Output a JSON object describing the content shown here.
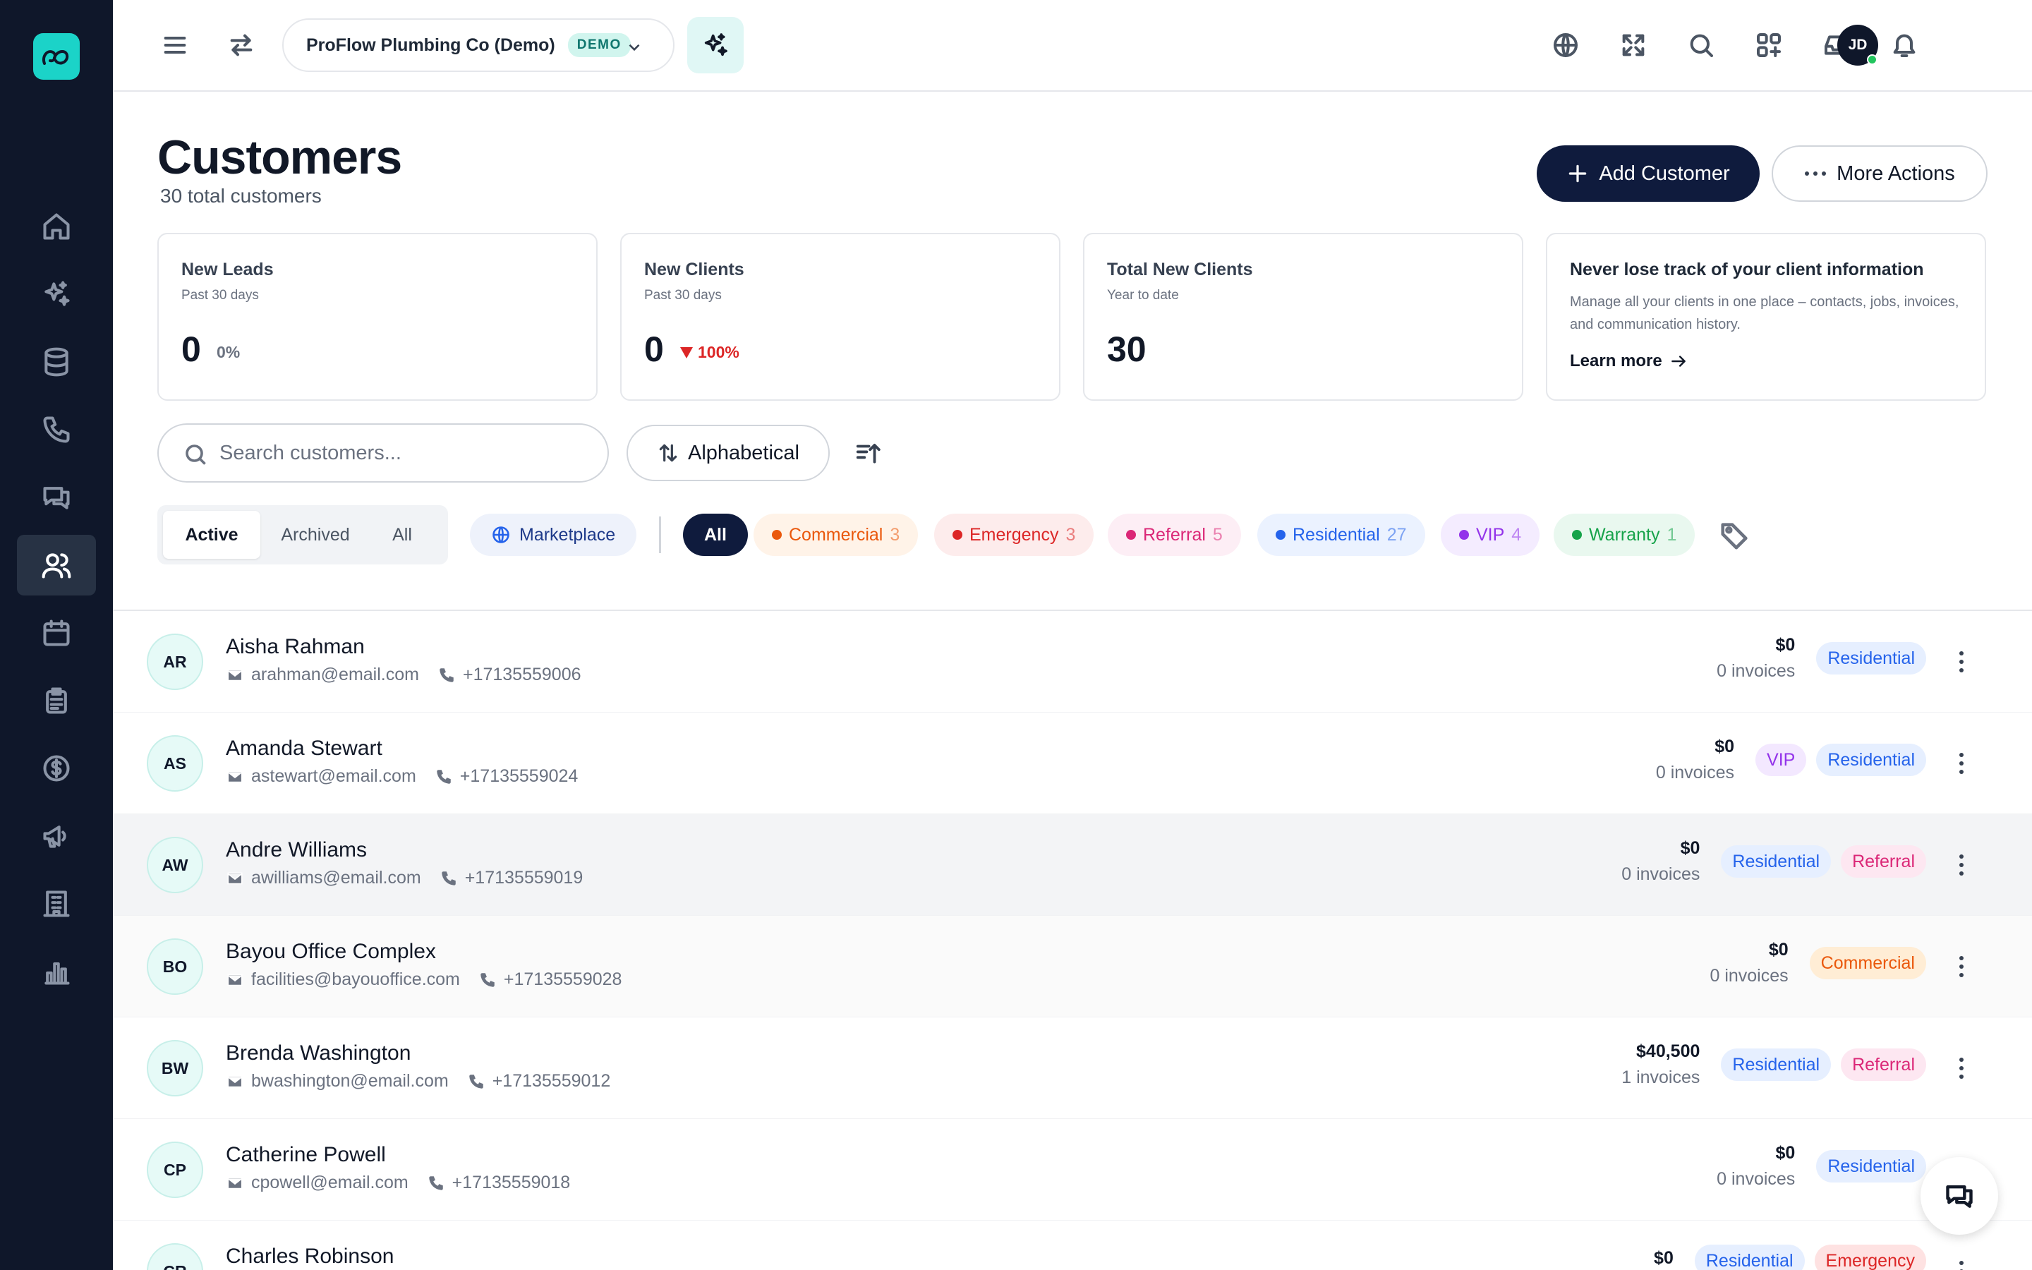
{
  "company": {
    "name": "ProFlow Plumbing Co (Demo)",
    "badge": "DEMO"
  },
  "user": {
    "initials": "JD"
  },
  "page": {
    "title": "Customers",
    "subtitle": "30 total customers"
  },
  "actions": {
    "add_label": "Add Customer",
    "more_label": "More Actions"
  },
  "stats": [
    {
      "label": "New Leads",
      "sublabel": "Past 30 days",
      "value": "0",
      "delta": "0%",
      "delta_color": "#6b7280"
    },
    {
      "label": "New Clients",
      "sublabel": "Past 30 days",
      "value": "0",
      "delta": "100%",
      "delta_color": "#dc2626"
    },
    {
      "label": "Total New Clients",
      "sublabel": "Year to date",
      "value": "30"
    }
  ],
  "info_card": {
    "title": "Never lose track of your client information",
    "description": "Manage all your clients in one place – contacts, jobs, invoices, and communication history.",
    "link": "Learn more"
  },
  "search": {
    "placeholder": "Search customers..."
  },
  "sort": {
    "label": "Alphabetical"
  },
  "status_tabs": [
    "Active",
    "Archived",
    "All"
  ],
  "marketplace_label": "Marketplace",
  "tag_filters": {
    "all": "All",
    "items": [
      {
        "label": "Commercial",
        "count": "3",
        "color": "#ea580c",
        "bg": "#fff3e8"
      },
      {
        "label": "Emergency",
        "count": "3",
        "color": "#dc2626",
        "bg": "#fdecec"
      },
      {
        "label": "Referral",
        "count": "5",
        "color": "#db2777",
        "bg": "#fdeef5"
      },
      {
        "label": "Residential",
        "count": "27",
        "color": "#2563eb",
        "bg": "#ebf2ff"
      },
      {
        "label": "VIP",
        "count": "4",
        "color": "#9333ea",
        "bg": "#f4ecff"
      },
      {
        "label": "Warranty",
        "count": "1",
        "color": "#16a34a",
        "bg": "#e9f8ef"
      }
    ]
  },
  "customers": [
    {
      "initials": "AR",
      "name": "Aisha Rahman",
      "email": "arahman@email.com",
      "phone": "+17135559006",
      "amount": "$0",
      "invoices": "0 invoices",
      "tags": [
        "Residential"
      ]
    },
    {
      "initials": "AS",
      "name": "Amanda Stewart",
      "email": "astewart@email.com",
      "phone": "+17135559024",
      "amount": "$0",
      "invoices": "0 invoices",
      "tags": [
        "VIP",
        "Residential"
      ]
    },
    {
      "initials": "AW",
      "name": "Andre Williams",
      "email": "awilliams@email.com",
      "phone": "+17135559019",
      "amount": "$0",
      "invoices": "0 invoices",
      "tags": [
        "Residential",
        "Referral"
      ]
    },
    {
      "initials": "BO",
      "name": "Bayou Office Complex",
      "email": "facilities@bayouoffice.com",
      "phone": "+17135559028",
      "amount": "$0",
      "invoices": "0 invoices",
      "tags": [
        "Commercial"
      ]
    },
    {
      "initials": "BW",
      "name": "Brenda Washington",
      "email": "bwashington@email.com",
      "phone": "+17135559012",
      "amount": "$40,500",
      "invoices": "1 invoices",
      "tags": [
        "Residential",
        "Referral"
      ]
    },
    {
      "initials": "CP",
      "name": "Catherine Powell",
      "email": "cpowell@email.com",
      "phone": "+17135559018",
      "amount": "$0",
      "invoices": "0 invoices",
      "tags": [
        "Residential"
      ]
    },
    {
      "initials": "CR",
      "name": "Charles Robinson",
      "email": "",
      "phone": "",
      "amount": "$0",
      "invoices": "",
      "tags": [
        "Residential",
        "Emergency"
      ]
    }
  ]
}
